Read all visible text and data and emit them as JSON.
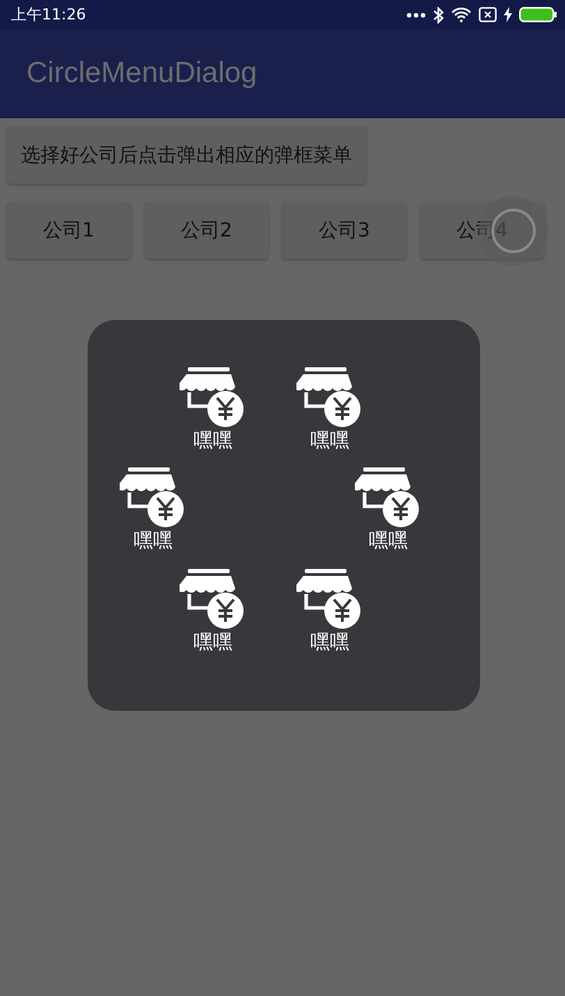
{
  "status_bar": {
    "time": "上午11:26"
  },
  "app_bar": {
    "title": "CircleMenuDialog"
  },
  "hint_button": "选择好公司后点击弹出相应的弹框菜单",
  "company_buttons": [
    {
      "label": "公司1",
      "pressed": false
    },
    {
      "label": "公司2",
      "pressed": false
    },
    {
      "label": "公司3",
      "pressed": false
    },
    {
      "label": "公司4",
      "pressed": true
    }
  ],
  "dialog": {
    "items": [
      {
        "label": "嘿嘿"
      },
      {
        "label": "嘿嘿"
      },
      {
        "label": "嘿嘿"
      },
      {
        "label": "嘿嘿"
      },
      {
        "label": "嘿嘿"
      },
      {
        "label": "嘿嘿"
      }
    ]
  }
}
